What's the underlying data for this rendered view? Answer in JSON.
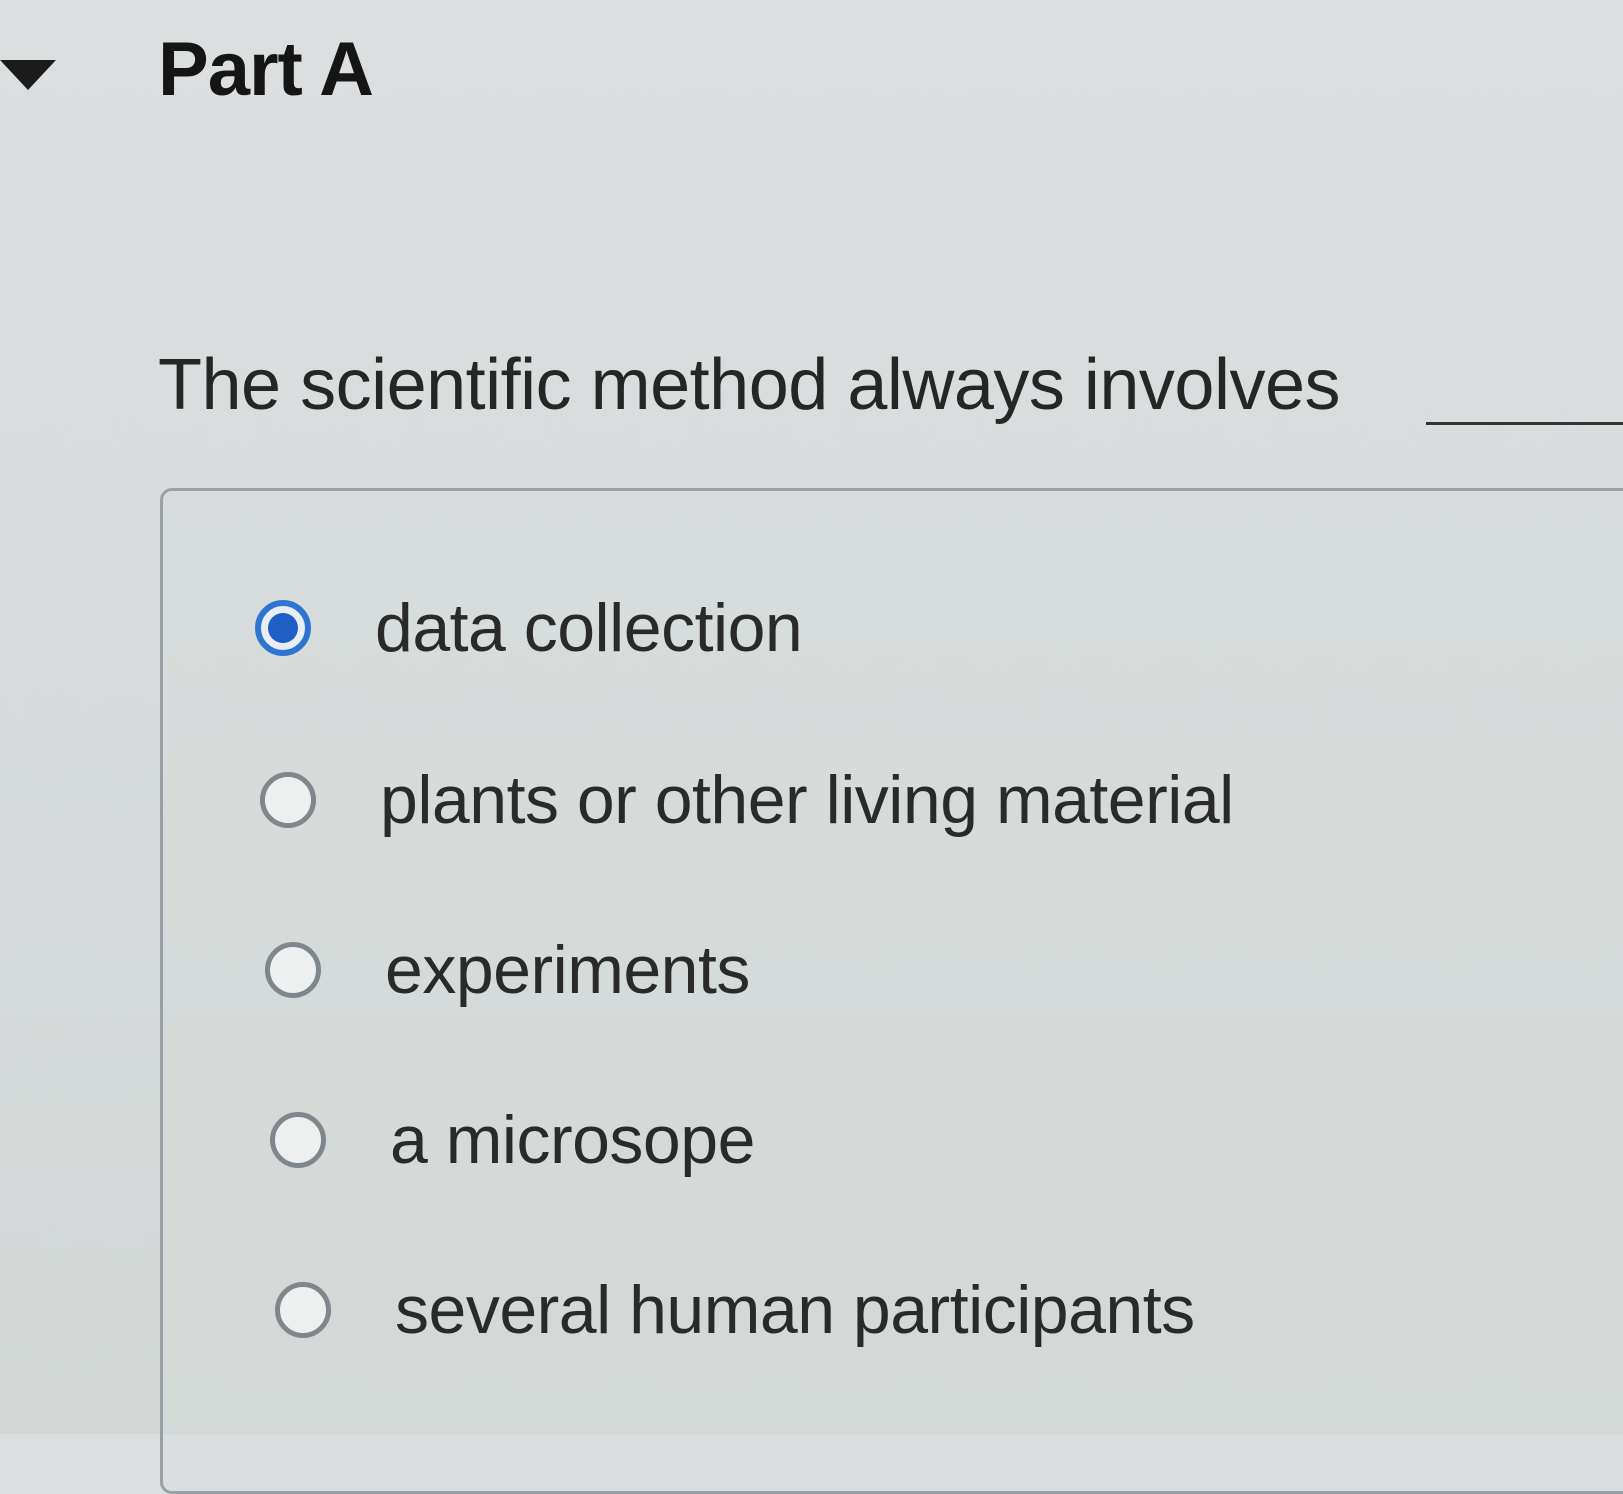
{
  "part": {
    "title": "Part A"
  },
  "question": {
    "text": "The scientific method always involves"
  },
  "choices": [
    {
      "label": "data collection",
      "selected": true
    },
    {
      "label": "plants or other living material",
      "selected": false
    },
    {
      "label": "experiments",
      "selected": false
    },
    {
      "label": "a microsope",
      "selected": false
    },
    {
      "label": "several human participants",
      "selected": false
    }
  ],
  "colors": {
    "selected_radio": "#2f74d0",
    "unselected_radio": "#7f878d"
  }
}
